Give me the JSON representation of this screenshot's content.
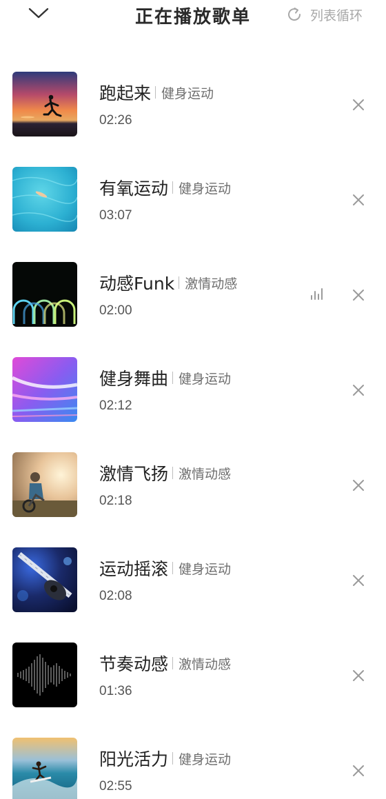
{
  "header": {
    "title": "正在播放歌单",
    "play_mode_label": "列表循环",
    "collapse_icon": "chevron-down-icon",
    "play_mode_icon": "repeat-icon"
  },
  "playlist": [
    {
      "title": "跑起来",
      "category": "健身运动",
      "duration": "02:26",
      "cover": "sunset-runner",
      "playing": false
    },
    {
      "title": "有氧运动",
      "category": "健身运动",
      "duration": "03:07",
      "cover": "ocean-swimmer",
      "playing": false
    },
    {
      "title": "动感Funk",
      "category": "激情动感",
      "duration": "02:00",
      "cover": "neon-arcs",
      "playing": true
    },
    {
      "title": "健身舞曲",
      "category": "健身运动",
      "duration": "02:12",
      "cover": "light-streaks",
      "playing": false
    },
    {
      "title": "激情飞扬",
      "category": "激情动感",
      "duration": "02:18",
      "cover": "motocross-rider",
      "playing": false
    },
    {
      "title": "运动摇滚",
      "category": "健身运动",
      "duration": "02:08",
      "cover": "electric-guitar",
      "playing": false
    },
    {
      "title": "节奏动感",
      "category": "激情动感",
      "duration": "01:36",
      "cover": "sound-wave",
      "playing": false
    },
    {
      "title": "阳光活力",
      "category": "健身运动",
      "duration": "02:55",
      "cover": "surfer",
      "playing": false
    }
  ],
  "colors": {
    "title_text": "#222222",
    "secondary_text": "#6f6f6f",
    "icon_gray": "#a8a8a8"
  }
}
